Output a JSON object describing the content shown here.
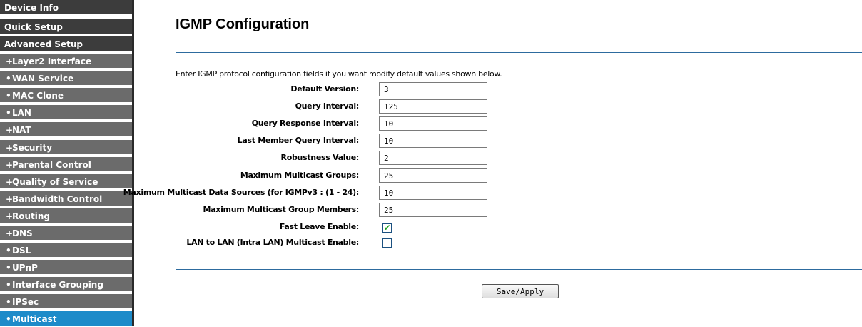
{
  "sidebar": {
    "items": [
      {
        "label": "Device Info",
        "marker": "",
        "kind": "top"
      },
      {
        "label": "Quick Setup",
        "marker": "",
        "kind": "top"
      },
      {
        "label": "Advanced Setup",
        "marker": "",
        "kind": "top"
      },
      {
        "label": "Layer2 Interface",
        "marker": "+",
        "kind": "sub"
      },
      {
        "label": "WAN Service",
        "marker": "•",
        "kind": "sub"
      },
      {
        "label": "MAC Clone",
        "marker": "•",
        "kind": "sub"
      },
      {
        "label": "LAN",
        "marker": "•",
        "kind": "sub"
      },
      {
        "label": "NAT",
        "marker": "+",
        "kind": "sub"
      },
      {
        "label": "Security",
        "marker": "+",
        "kind": "sub"
      },
      {
        "label": "Parental Control",
        "marker": "+",
        "kind": "sub"
      },
      {
        "label": "Quality of Service",
        "marker": "+",
        "kind": "sub"
      },
      {
        "label": "Bandwidth Control",
        "marker": "+",
        "kind": "sub"
      },
      {
        "label": "Routing",
        "marker": "+",
        "kind": "sub"
      },
      {
        "label": "DNS",
        "marker": "+",
        "kind": "sub"
      },
      {
        "label": "DSL",
        "marker": "•",
        "kind": "sub"
      },
      {
        "label": "UPnP",
        "marker": "•",
        "kind": "sub"
      },
      {
        "label": "Interface Grouping",
        "marker": "•",
        "kind": "sub"
      },
      {
        "label": "IPSec",
        "marker": "•",
        "kind": "sub"
      },
      {
        "label": "Multicast",
        "marker": "•",
        "kind": "sub",
        "active": true
      }
    ]
  },
  "main": {
    "title": "IGMP Configuration",
    "intro": "Enter IGMP protocol configuration fields if you want modify default values shown below.",
    "fields": [
      {
        "label": "Default Version:",
        "value": "3"
      },
      {
        "label": "Query Interval:",
        "value": "125"
      },
      {
        "label": "Query Response Interval:",
        "value": "10"
      },
      {
        "label": "Last Member Query Interval:",
        "value": "10"
      },
      {
        "label": "Robustness Value:",
        "value": "2"
      },
      {
        "label": "Maximum Multicast Groups:",
        "value": "25"
      },
      {
        "label": "Maximum Multicast Data Sources (for IGMPv3 : (1 - 24):",
        "value": "10"
      },
      {
        "label": "Maximum Multicast Group Members:",
        "value": "25"
      }
    ],
    "checkboxes": [
      {
        "label": "Fast Leave Enable:",
        "checked": true
      },
      {
        "label": "LAN to LAN (Intra LAN) Multicast Enable:",
        "checked": false
      }
    ],
    "save_label": "Save/Apply"
  },
  "colors": {
    "active_nav": "#1d8bc9",
    "top_nav": "#3c3c3c",
    "sub_nav": "#6b6b6b",
    "rule": "#2d6b9e",
    "check_tick": "#21a121"
  }
}
